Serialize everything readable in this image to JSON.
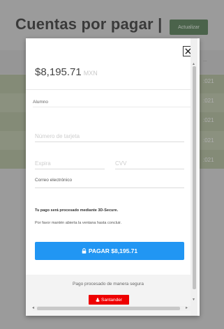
{
  "page": {
    "title": "Cuentas por pagar |",
    "update_button": "Actualizar",
    "table_header_fragment": "...",
    "row_dates": [
      ":021",
      ":021",
      ":021",
      ":021",
      ":021"
    ]
  },
  "modal": {
    "amount": "$8,195.71",
    "currency": "MXN",
    "student_label": "Alumno",
    "card_number_placeholder": "Número de tarjeta",
    "expiry_placeholder": "Expira",
    "cvv_placeholder": "CVV",
    "email_label": "Correo electrónico",
    "notice_3d": "Tu pago será procesado mediante 3D-Secure.",
    "notice_window": "Por favor mantén abierta la ventana hasta concluir.",
    "pay_button": "PAGAR $8,195.71",
    "secure_text": "Pago procesado de manera segura",
    "bank_logo": "Santander"
  },
  "colors": {
    "pay_button": "#2196f3",
    "bank_logo": "#e00000",
    "update_button": "#3e6b3e",
    "row_band": "#a7b38e"
  },
  "icons": {
    "close": "close-icon",
    "pay": "lock-icon",
    "bank": "flame-icon"
  }
}
